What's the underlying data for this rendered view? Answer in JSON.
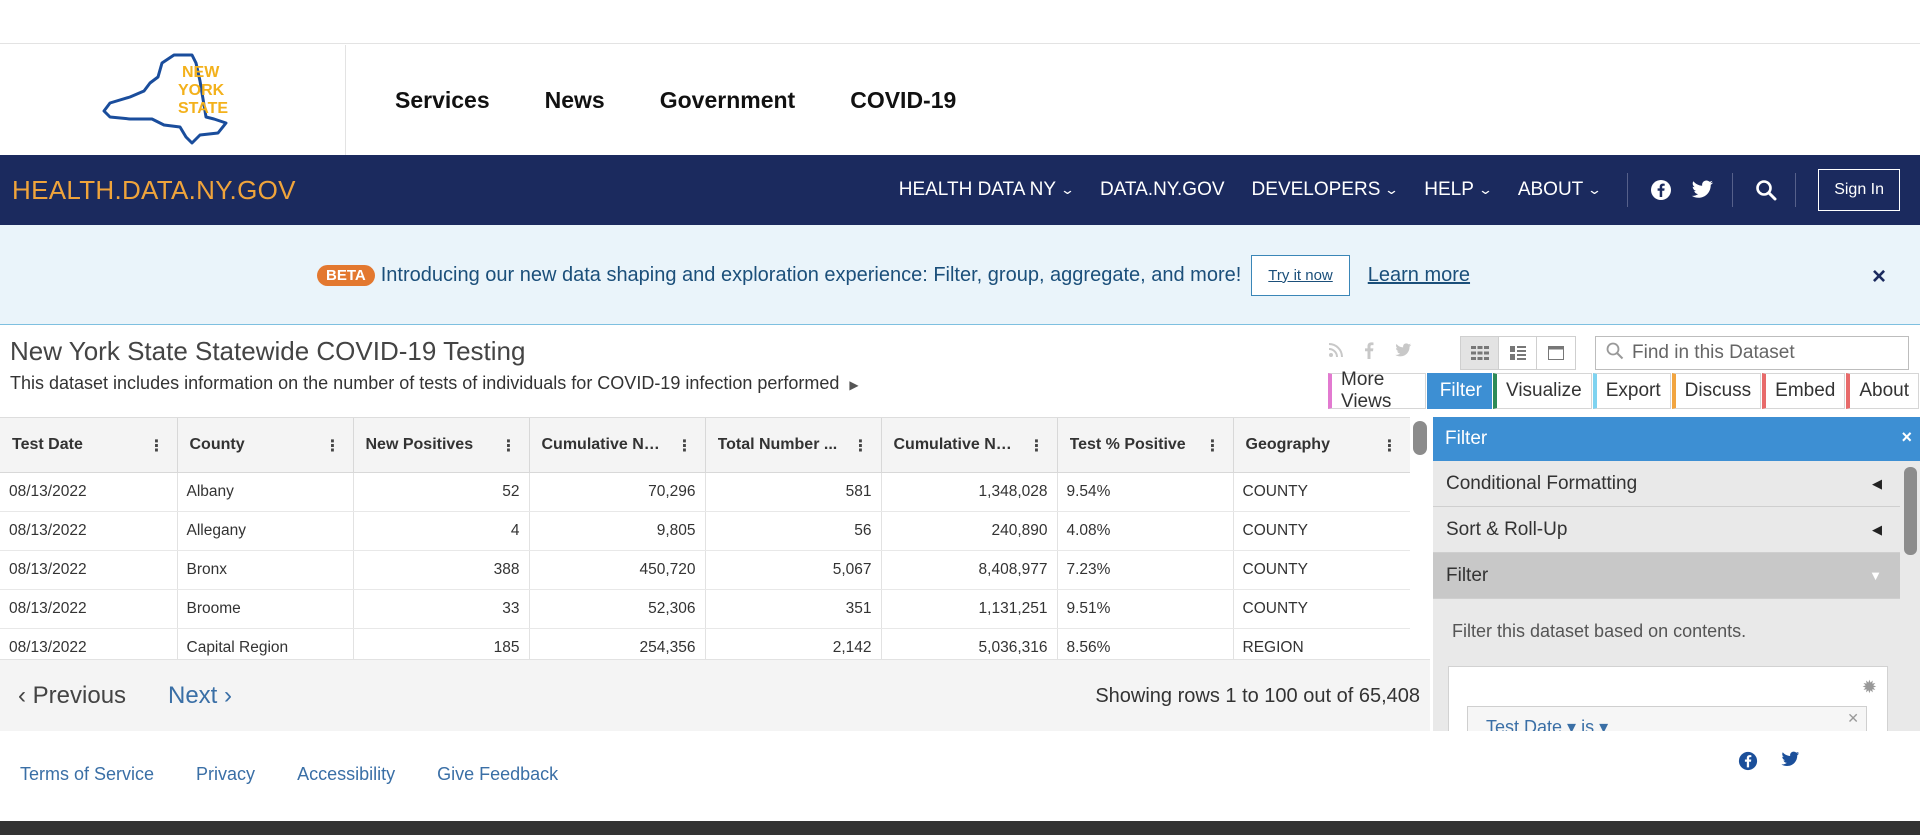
{
  "state_logo": {
    "line1": "NEW",
    "line2": "YORK",
    "line3": "STATE"
  },
  "state_nav": [
    "Services",
    "News",
    "Government",
    "COVID-19"
  ],
  "site": {
    "title": "HEALTH.DATA.NY.GOV",
    "nav": [
      {
        "label": "HEALTH DATA NY",
        "dropdown": true
      },
      {
        "label": "DATA.NY.GOV",
        "dropdown": false
      },
      {
        "label": "DEVELOPERS",
        "dropdown": true
      },
      {
        "label": "HELP",
        "dropdown": true
      },
      {
        "label": "ABOUT",
        "dropdown": true
      }
    ],
    "sign_in": "Sign In"
  },
  "banner": {
    "badge": "BETA",
    "text": "Introducing our new data shaping and exploration experience: Filter, group, aggregate, and more!",
    "try_label": "Try it now",
    "learn_label": "Learn more",
    "close": "×"
  },
  "dataset": {
    "title": "New York State Statewide COVID-19 Testing",
    "description": "This dataset includes information on the number of tests of individuals for COVID-19 infection performed",
    "search_placeholder": "Find in this Dataset",
    "tabs": [
      {
        "label": "More Views",
        "color": "#e27ad0"
      },
      {
        "label": "Filter",
        "color": "#3d8fd3",
        "active": true
      },
      {
        "label": "Visualize",
        "color": "#2e8b57"
      },
      {
        "label": "Export",
        "color": "#7fd3f0"
      },
      {
        "label": "Discuss",
        "color": "#f2a540"
      },
      {
        "label": "Embed",
        "color": "#e86b6b"
      },
      {
        "label": "About",
        "color": "#e86b6b"
      }
    ]
  },
  "table": {
    "columns": [
      "Test Date",
      "County",
      "New Positives",
      "Cumulative Nu...",
      "Total Number ...",
      "Cumulative Nu...",
      "Test % Positive",
      "Geography"
    ],
    "numeric": [
      false,
      false,
      true,
      true,
      true,
      true,
      false,
      false
    ],
    "rows": [
      [
        "08/13/2022",
        "Albany",
        "52",
        "70,296",
        "581",
        "1,348,028",
        "9.54%",
        "COUNTY"
      ],
      [
        "08/13/2022",
        "Allegany",
        "4",
        "9,805",
        "56",
        "240,890",
        "4.08%",
        "COUNTY"
      ],
      [
        "08/13/2022",
        "Bronx",
        "388",
        "450,720",
        "5,067",
        "8,408,977",
        "7.23%",
        "COUNTY"
      ],
      [
        "08/13/2022",
        "Broome",
        "33",
        "52,306",
        "351",
        "1,131,251",
        "9.51%",
        "COUNTY"
      ],
      [
        "08/13/2022",
        "Capital Region",
        "185",
        "254,356",
        "2,142",
        "5,036,316",
        "8.56%",
        "REGION"
      ]
    ]
  },
  "pager": {
    "previous": "Previous",
    "next": "Next",
    "showing": "Showing rows 1 to 100 out of 65,408"
  },
  "panel": {
    "title": "Filter",
    "close": "×",
    "sections": [
      {
        "label": "Conditional Formatting",
        "open": false
      },
      {
        "label": "Sort & Roll-Up",
        "open": false
      },
      {
        "label": "Filter",
        "open": true
      }
    ],
    "description": "Filter this dataset based on contents.",
    "filter_label": "Test Date ▾ is ▾"
  },
  "footer": {
    "links": [
      "Terms of Service",
      "Privacy",
      "Accessibility",
      "Give Feedback"
    ]
  },
  "colors": {
    "navy": "#1b2a5e",
    "orange": "#f0a43b",
    "blue": "#3d8fd3",
    "logo_blue": "#1a4d9c",
    "logo_gold": "#f3b11b"
  }
}
